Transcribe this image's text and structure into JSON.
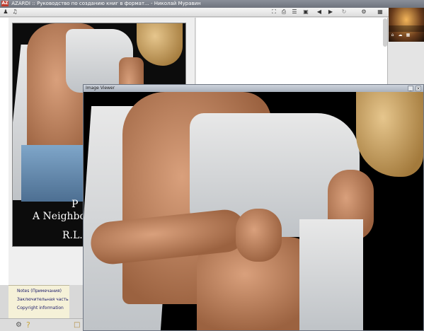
{
  "window": {
    "title": "AZARDI :: Руководство по созданию книг в формат... - Николай Муравин",
    "logo_text": "AZ"
  },
  "toolbar": {
    "left_icons": [
      "person-icon",
      "speaker-icon"
    ],
    "right_icons": [
      "fullscreen-icon",
      "print-icon",
      "toc-icon",
      "bookmark-icon",
      "prev-icon",
      "next-icon",
      "refresh-icon",
      "settings-icon",
      "library-icon"
    ]
  },
  "cover": {
    "line1": "P",
    "line2": "A Neighbo",
    "line3": "R.L."
  },
  "toc_panel": {
    "items": [
      "Notes (Примечания)",
      "Заключительная часть",
      "Copyright information"
    ]
  },
  "image_viewer": {
    "title": "Image Viewer",
    "minimize": "_",
    "close": "×"
  },
  "colors": {
    "title_bar": "#7a7f89",
    "viewer_title": "#b9c0cb",
    "toc_bg": "#f5f1d8",
    "link": "#1a1a6a"
  }
}
